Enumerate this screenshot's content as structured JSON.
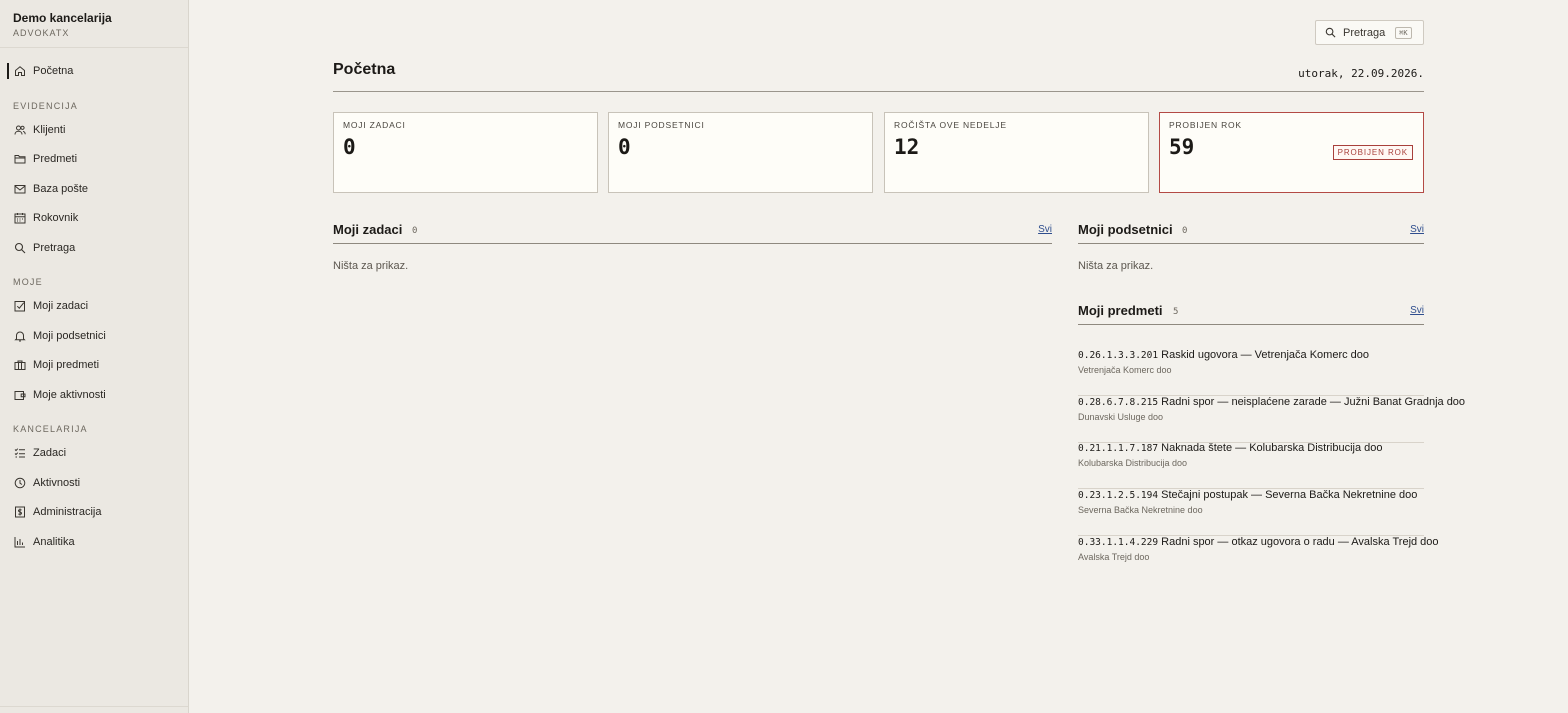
{
  "brand": {
    "name": "Demo kancelarija",
    "sub": "ADVOKATX"
  },
  "nav": {
    "home": "Početna",
    "section_evidencija": "EVIDENCIJA",
    "klijenti": "Klijenti",
    "predmeti": "Predmeti",
    "baza_poste": "Baza pošte",
    "rokovnik": "Rokovnik",
    "pretraga": "Pretraga",
    "section_moje": "MOJE",
    "moji_zadaci": "Moji zadaci",
    "moji_podsetnici": "Moji podsetnici",
    "moji_predmeti": "Moji predmeti",
    "moje_aktivnosti": "Moje aktivnosti",
    "section_kancelarija": "KANCELARIJA",
    "zadaci": "Zadaci",
    "aktivnosti": "Aktivnosti",
    "administracija": "Administracija",
    "analitika": "Analitika"
  },
  "search": {
    "label": "Pretraga",
    "shortcut": "⌘K"
  },
  "page": {
    "title": "Početna",
    "date": "utorak, 22.09.2026."
  },
  "cards": [
    {
      "label": "MOJI ZADACI",
      "value": "0"
    },
    {
      "label": "MOJI PODSETNICI",
      "value": "0"
    },
    {
      "label": "ROČIŠTA OVE NEDELJE",
      "value": "12"
    },
    {
      "label": "PROBIJEN ROK",
      "value": "59",
      "badge": "PROBIJEN ROK"
    }
  ],
  "tasks": {
    "title": "Moji zadaci",
    "count": "0",
    "link": "Svi",
    "empty": "Ništa za prikaz."
  },
  "reminders": {
    "title": "Moji podsetnici",
    "count": "0",
    "link": "Svi",
    "empty": "Ništa za prikaz."
  },
  "matters": {
    "title": "Moji predmeti",
    "count": "5",
    "link": "Svi",
    "items": [
      {
        "code": "0.26.1.3.3.201",
        "title": "Raskid ugovora — Vetrenjača Komerc doo",
        "client": "Vetrenjača Komerc doo"
      },
      {
        "code": "0.28.6.7.8.215",
        "title": "Radni spor — neisplaćene zarade — Južni Banat Gradnja doo",
        "client": "Dunavski Usluge doo"
      },
      {
        "code": "0.21.1.1.7.187",
        "title": "Naknada štete — Kolubarska Distribucija doo",
        "client": "Kolubarska Distribucija doo"
      },
      {
        "code": "0.23.1.2.5.194",
        "title": "Stečajni postupak — Severna Bačka Nekretnine doo",
        "client": "Severna Bačka Nekretnine doo"
      },
      {
        "code": "0.33.1.1.4.229",
        "title": "Radni spor — otkaz ugovora o radu — Avalska Trejd doo",
        "client": "Avalska Trejd doo"
      }
    ]
  },
  "colors": {
    "accent": "#2f4e8e",
    "alert": "#a8403b",
    "background": "#f3f1ec",
    "sidebar": "#ebe8e2"
  }
}
